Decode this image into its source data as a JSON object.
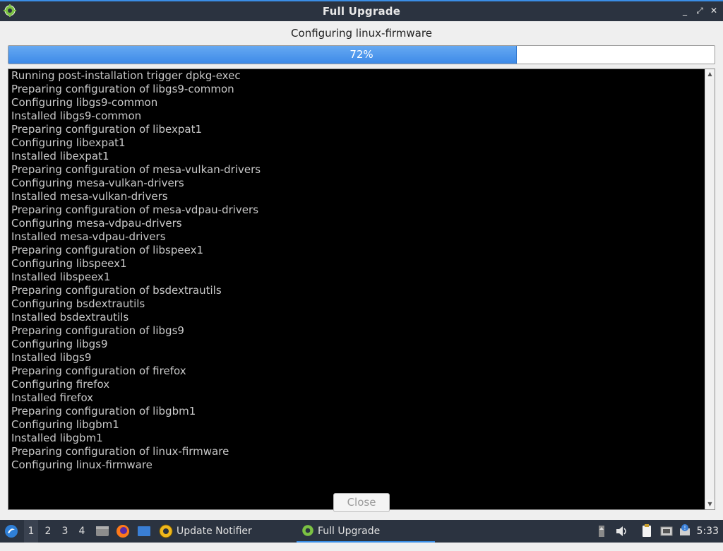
{
  "window": {
    "title": "Full Upgrade",
    "controls": {
      "minimize": "_",
      "maximize": "⤢",
      "close": "✕"
    }
  },
  "status": {
    "label": "Configuring linux-firmware",
    "progress_percent": 72,
    "progress_text": "72%"
  },
  "log": {
    "lines": [
      "Running post-installation trigger dpkg-exec",
      "Preparing configuration of libgs9-common",
      "Configuring libgs9-common",
      "Installed libgs9-common",
      "Preparing configuration of libexpat1",
      "Configuring libexpat1",
      "Installed libexpat1",
      "Preparing configuration of mesa-vulkan-drivers",
      "Configuring mesa-vulkan-drivers",
      "Installed mesa-vulkan-drivers",
      "Preparing configuration of mesa-vdpau-drivers",
      "Configuring mesa-vdpau-drivers",
      "Installed mesa-vdpau-drivers",
      "Preparing configuration of libspeex1",
      "Configuring libspeex1",
      "Installed libspeex1",
      "Preparing configuration of bsdextrautils",
      "Configuring bsdextrautils",
      "Installed bsdextrautils",
      "Preparing configuration of libgs9",
      "Configuring libgs9",
      "Installed libgs9",
      "Preparing configuration of firefox",
      "Configuring firefox",
      "Installed firefox",
      "Preparing configuration of libgbm1",
      "Configuring libgbm1",
      "Installed libgbm1",
      "Preparing configuration of linux-firmware",
      "Configuring linux-firmware"
    ]
  },
  "buttons": {
    "close_label": "Close"
  },
  "taskbar": {
    "workspaces": [
      "1",
      "2",
      "3",
      "4"
    ],
    "active_workspace": "1",
    "tasks": [
      {
        "label": "Update Notifier",
        "icon": "update-notifier-icon"
      },
      {
        "label": "Full Upgrade",
        "icon": "gear-icon"
      }
    ],
    "clock": "5:33"
  },
  "colors": {
    "accent": "#3a8ee6",
    "titlebar": "#2b3340",
    "log_background": "#000000",
    "log_text": "#c9c9c9"
  }
}
